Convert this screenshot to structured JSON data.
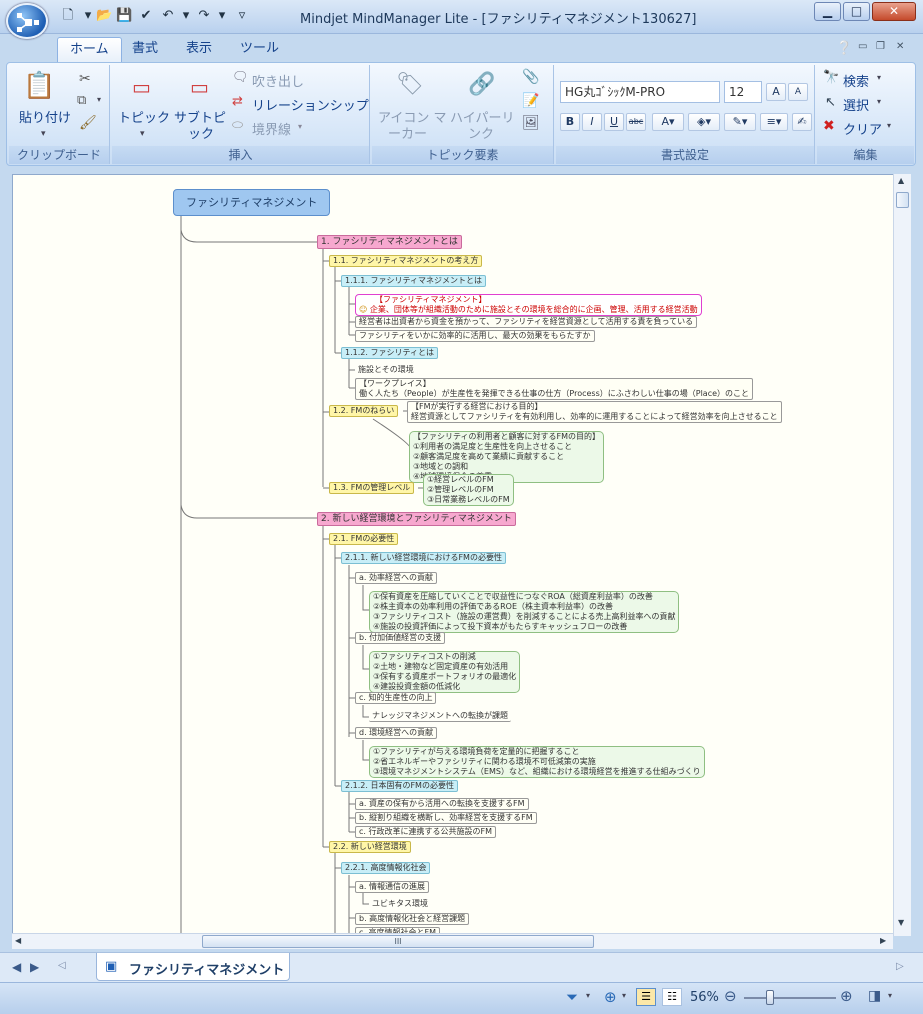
{
  "window": {
    "title": "Mindjet MindManager Lite - [ファシリティマネジメント130627]",
    "minimize": "▁",
    "maximize": "□",
    "close": "✕"
  },
  "tabs": [
    "ホーム",
    "書式",
    "表示",
    "ツール"
  ],
  "ribbon": {
    "clipboard": {
      "title": "クリップボード",
      "paste": "貼り付け"
    },
    "insert": {
      "title": "挿入",
      "topic": "トピック",
      "subtopic": "サブトピ",
      "subtopic2": "ック",
      "callout": "吹き出し",
      "relationship": "リレーションシップ",
      "boundary": "境界線"
    },
    "topic_elements": {
      "title": "トピック要素",
      "icon_marker": "アイコン マ",
      "icon_marker2": "ーカー",
      "hyperlink": "ハイパーリ",
      "hyperlink2": "ンク"
    },
    "format": {
      "title": "書式設定",
      "font": "HG丸ｺﾞｼｯｸM-PRO",
      "size": "12",
      "bold": "B",
      "italic": "I",
      "underline": "U",
      "strike": "abc"
    },
    "edit": {
      "title": "編集",
      "search": "検索",
      "select": "選択",
      "clear": "クリア"
    }
  },
  "map": {
    "central": "ファシリティマネジメント",
    "n1": "1. ファシリティマネジメントとは",
    "n11": "1.1. ファシリティマネジメントの考え方",
    "n111": "1.1.1. ファシリティマネジメントとは",
    "n111_red1": "【ファシリティマネジメント】",
    "n111_red2": "企業、団体等が組織活動のために施設とその環境を総合的に企画、管理、活用する経営活動",
    "n111_a": "経営者は出資者から資金を預かって、ファシリティを経営資源として活用する責を負っている",
    "n111_b": "ファシリティをいかに効率的に活用し、最大の効果をもらたすか",
    "n112": "1.1.2. ファシリティとは",
    "n112_a": "施設とその環境",
    "n112_b1": "【ワークプレイス】",
    "n112_b2": "働く人たち（People）が生産性を発揮できる仕事の仕方（Process）にふさわしい仕事の場（Place）のこと",
    "n12": "1.2. FMのねらい",
    "n12_a1": "【FMが実行する経営における目的】",
    "n12_a2": "経営資源としてファシリティを有効利用し、効率的に運用することによって経営効率を向上させること",
    "n12_b": "【ファシリティの利用者と顧客に対するFMの目的】\n①利用者の満足度と生産性を向上させること\n②顧客満足度を高めて業績に貢献すること\n③地域との調和\n④地球環境保全の尊重",
    "n13": "1.3. FMの管理レベル",
    "n13_a": "①経営レベルのFM\n②管理レベルのFM\n③日常業務レベルのFM",
    "n2": "2. 新しい経営環境とファシリティマネジメント",
    "n21": "2.1. FMの必要性",
    "n211": "2.1.1. 新しい経営環境におけるFMの必要性",
    "n211a": "a. 効率経営への貢献",
    "n211a_c": "①保有資産を圧縮していくことで収益性につなぐROA（総資産利益率）の改善\n②株主資本の効率利用の評価であるROE（株主資本利益率）の改善\n③ファシリティコスト（施設の運営費）を削減することによる売上高利益率への貢献\n④施設の投資評価によって投下資本がもたらすキャッシュフローの改善",
    "n211b": "b. 付加価値経営の支援",
    "n211b_c": "①ファシリティコストの削減\n②土地・建物など固定資産の有効活用\n③保有する資産ポートフォリオの最適化\n④建設投資金額の低減化",
    "n211c": "c. 知的生産性の向上",
    "n211c_a": "ナレッジマネジメントへの転換が課題",
    "n211d": "d. 環境経営への貢献",
    "n211d_c": "①ファシリティが与える環境負荷を定量的に把握すること\n②省エネルギーやファシリティに関わる環境不可低減策の実施\n③環境マネジメントシステム（EMS）など、組織における環境経営を推進する仕組みづくり",
    "n212": "2.1.2. 日本固有のFMの必要性",
    "n212a": "a. 資産の保有から活用への転換を支援するFM",
    "n212b": "b. 縦割り組織を横断し、効率経営を支援するFM",
    "n212c": "c. 行政改革に連携する公共施設のFM",
    "n22": "2.2. 新しい経営環境",
    "n221": "2.2.1. 高度情報化社会",
    "n221a": "a. 情報通信の進展",
    "n221a_a": "ユビキタス環境",
    "n221b": "b. 高度情報化社会と経営課題",
    "n221c": "c. 高度情報社会とFM"
  },
  "doc_tab": "ファシリティマネジメント",
  "status": {
    "zoom": "56%"
  },
  "scroll_grip": "III"
}
